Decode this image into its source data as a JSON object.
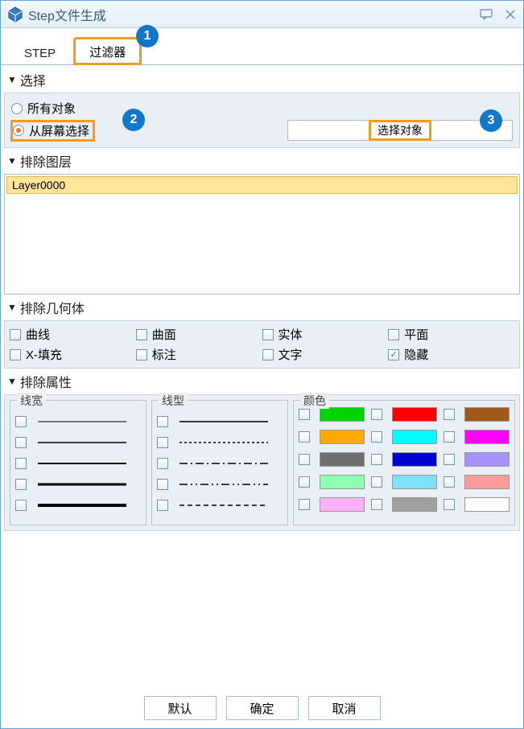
{
  "window": {
    "title": "Step文件生成"
  },
  "tabs": {
    "step": "STEP",
    "filter": "过滤器"
  },
  "callouts": {
    "c1": "1",
    "c2": "2",
    "c3": "3"
  },
  "select": {
    "header": "选择",
    "all": "所有对象",
    "fromScreen": "从屏幕选择",
    "pick": "选择对象"
  },
  "excludeLayer": {
    "header": "排除图层",
    "items": [
      "Layer0000"
    ]
  },
  "excludeGeom": {
    "header": "排除几何体",
    "curve": "曲线",
    "surface": "曲面",
    "solid": "实体",
    "plane": "平面",
    "xfill": "X-填充",
    "annot": "标注",
    "text": "文字",
    "hidden": "隐藏"
  },
  "excludeAttr": {
    "header": "排除属性",
    "linewidth": "线宽",
    "linetype": "线型",
    "color": "颜色"
  },
  "colors": [
    "#00d400",
    "#ff0000",
    "#a05a1a",
    "#ffaa00",
    "#00ffff",
    "#ff00ff",
    "#6f6f6f",
    "#0000d0",
    "#a890ff",
    "#90ffb0",
    "#80e0ff",
    "#ff9a9a",
    "#ffb0ff",
    "#a0a0a0",
    "#ffffff"
  ],
  "footer": {
    "default": "默认",
    "ok": "确定",
    "cancel": "取消"
  }
}
